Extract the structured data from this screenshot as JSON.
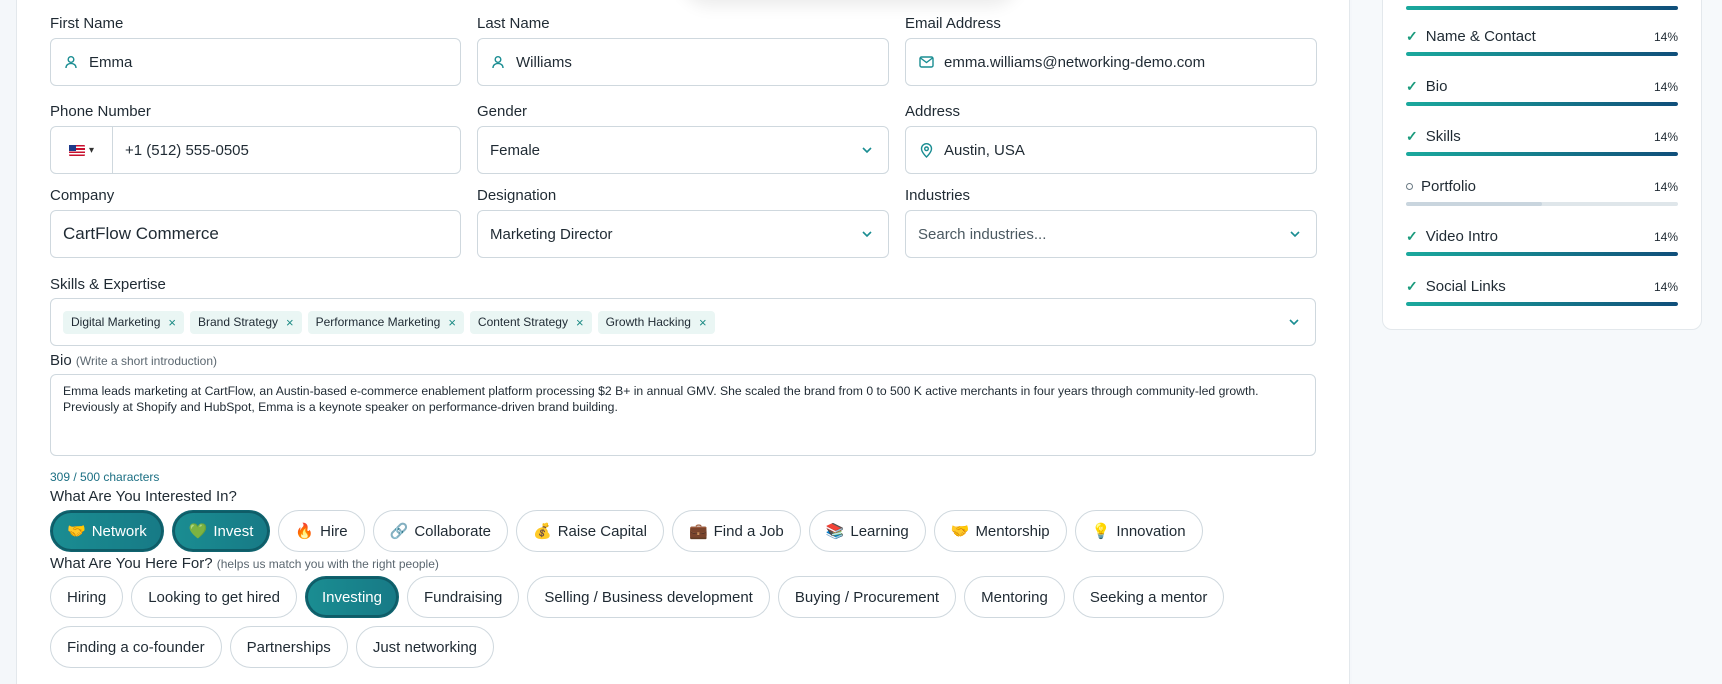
{
  "form": {
    "first_name": {
      "label": "First Name",
      "value": "Emma",
      "icon": "person-icon"
    },
    "last_name": {
      "label": "Last Name",
      "value": "Williams",
      "icon": "person-icon"
    },
    "email": {
      "label": "Email Address",
      "value": "emma.williams@networking-demo.com",
      "icon": "mail-icon"
    },
    "phone": {
      "label": "Phone Number",
      "value": "+1 (512) 555-0505",
      "country": "US"
    },
    "gender": {
      "label": "Gender",
      "value": "Female"
    },
    "address": {
      "label": "Address",
      "value": "Austin, USA",
      "icon": "location-pin-icon"
    },
    "company": {
      "label": "Company",
      "value": "CartFlow Commerce"
    },
    "designation": {
      "label": "Designation",
      "value": "Marketing Director"
    },
    "industries": {
      "label": "Industries",
      "placeholder": "Search industries..."
    },
    "skills": {
      "label": "Skills & Expertise",
      "tags": [
        "Digital Marketing",
        "Brand Strategy",
        "Performance Marketing",
        "Content Strategy",
        "Growth Hacking"
      ]
    },
    "bio": {
      "label": "Bio",
      "hint": "(Write a short introduction)",
      "value": "Emma leads marketing at CartFlow, an Austin-based e-commerce enablement platform processing $2 B+ in annual GMV. She scaled the brand from 0 to 500 K active merchants in four years through community-led growth. Previously at Shopify and HubSpot, Emma is a keynote speaker on performance-driven brand building.",
      "counter": "309 / 500 characters"
    },
    "interests": {
      "label": "What Are You Interested In?",
      "options": [
        {
          "emoji": "🤝",
          "label": "Network",
          "selected": true
        },
        {
          "emoji": "💚",
          "label": "Invest",
          "selected": true
        },
        {
          "emoji": "🔥",
          "label": "Hire",
          "selected": false
        },
        {
          "emoji": "🔗",
          "label": "Collaborate",
          "selected": false
        },
        {
          "emoji": "💰",
          "label": "Raise Capital",
          "selected": false
        },
        {
          "emoji": "💼",
          "label": "Find a Job",
          "selected": false
        },
        {
          "emoji": "📚",
          "label": "Learning",
          "selected": false
        },
        {
          "emoji": "🤝",
          "label": "Mentorship",
          "selected": false
        },
        {
          "emoji": "💡",
          "label": "Innovation",
          "selected": false
        }
      ]
    },
    "here_for": {
      "label": "What Are You Here For?",
      "hint": "(helps us match you with the right people)",
      "row1": [
        {
          "label": "Hiring",
          "selected": false
        },
        {
          "label": "Looking to get hired",
          "selected": false
        },
        {
          "label": "Investing",
          "selected": true
        },
        {
          "label": "Fundraising",
          "selected": false
        },
        {
          "label": "Selling / Business development",
          "selected": false
        },
        {
          "label": "Buying / Procurement",
          "selected": false
        },
        {
          "label": "Mentoring",
          "selected": false
        },
        {
          "label": "Seeking a mentor",
          "selected": false
        }
      ],
      "row2": [
        {
          "label": "Finding a co-founder",
          "selected": false
        },
        {
          "label": "Partnerships",
          "selected": false
        },
        {
          "label": "Just networking",
          "selected": false
        }
      ]
    }
  },
  "progress": {
    "items": [
      {
        "label": "Name & Contact",
        "pct": "14%",
        "done": true,
        "fill": 1.0
      },
      {
        "label": "Bio",
        "pct": "14%",
        "done": true,
        "fill": 1.0
      },
      {
        "label": "Skills",
        "pct": "14%",
        "done": true,
        "fill": 1.0
      },
      {
        "label": "Portfolio",
        "pct": "14%",
        "done": false,
        "fill": 0.5
      },
      {
        "label": "Video Intro",
        "pct": "14%",
        "done": true,
        "fill": 1.0
      },
      {
        "label": "Social Links",
        "pct": "14%",
        "done": true,
        "fill": 1.0
      }
    ]
  },
  "colors": {
    "accent": "#1a8d92",
    "accent_dark": "#104e7a",
    "check": "#1a9a7c"
  }
}
